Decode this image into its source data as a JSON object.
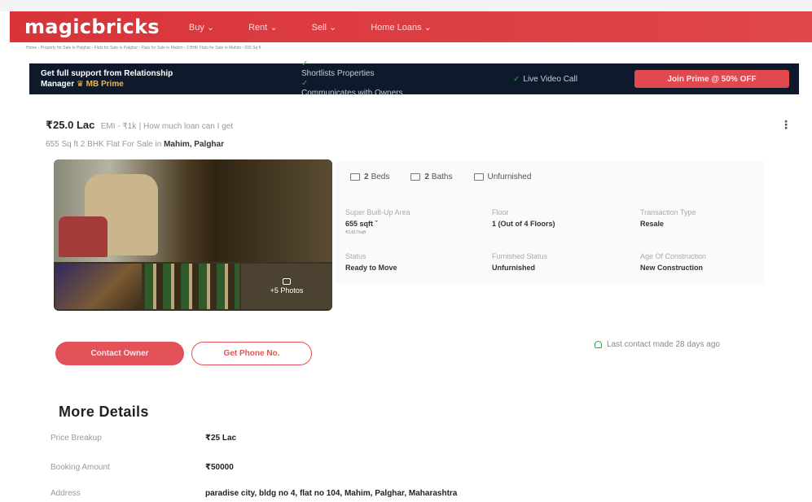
{
  "header": {
    "logo": "magicbricks",
    "menu": [
      "Buy ⌄",
      "Rent ⌄",
      "Sell ⌄",
      "Home Loans ⌄"
    ]
  },
  "breadcrumb": "Home › Property for Sale in Palghar › Flats for Sale in Palghar › Flats for Sale in Mahim › 2 BHK Flats for Sale in Mahim › 655 Sq ft",
  "prime_bar": {
    "line1": "Get full support from Relationship",
    "line2_prefix": "Manager",
    "line2_brand": "♛ MB Prime",
    "feature1": "Shortlists Properties",
    "feature2": "Communicates with Owners",
    "feature3": "Live Video Call",
    "join_label": "Join Prime @ 50% OFF"
  },
  "listing": {
    "price": "₹25.0 Lac",
    "emi": "EMI - ₹1k",
    "loan_link": "| How much loan can I get",
    "subtitle_prefix": "655 Sq ft 2 BHK Flat For Sale in",
    "locality": "Mahim, Palghar",
    "photos_label": "+5 Photos"
  },
  "features": [
    {
      "icon": "bed-icon",
      "value": "2",
      "label": "Beds"
    },
    {
      "icon": "bath-icon",
      "value": "2",
      "label": "Baths"
    },
    {
      "icon": "furnish-icon",
      "value": "",
      "label": "Unfurnished"
    }
  ],
  "specs": {
    "super_area_label": "Super Built-Up Area",
    "super_area_value": "655 sqft ˇ",
    "super_area_rate": "₹3,817/sqft",
    "floor_label": "Floor",
    "floor_value": "1 (Out of 4 Floors)",
    "transaction_label": "Transaction Type",
    "transaction_value": "Resale",
    "status_label": "Status",
    "status_value": "Ready to Move",
    "furnished_label": "Furnished Status",
    "furnished_value": "Unfurnished",
    "age_label": "Age Of Construction",
    "age_value": "New Construction"
  },
  "actions": {
    "contact_owner": "Contact Owner",
    "get_phone": "Get Phone No.",
    "last_contact": "Last contact made 28 days ago"
  },
  "more_details": {
    "title": "More Details",
    "rows": [
      {
        "label": "Price Breakup",
        "value": "₹25 Lac"
      },
      {
        "label": "Booking Amount",
        "value": "₹50000"
      },
      {
        "label": "Address",
        "value": "paradise city, bldg no 4, flat no 104, Mahim, Palghar, Maharashtra"
      }
    ]
  },
  "colors": {
    "brand": "#d8232a",
    "prime_bg": "#0e1a2b",
    "accent_green": "#2aa84a"
  }
}
